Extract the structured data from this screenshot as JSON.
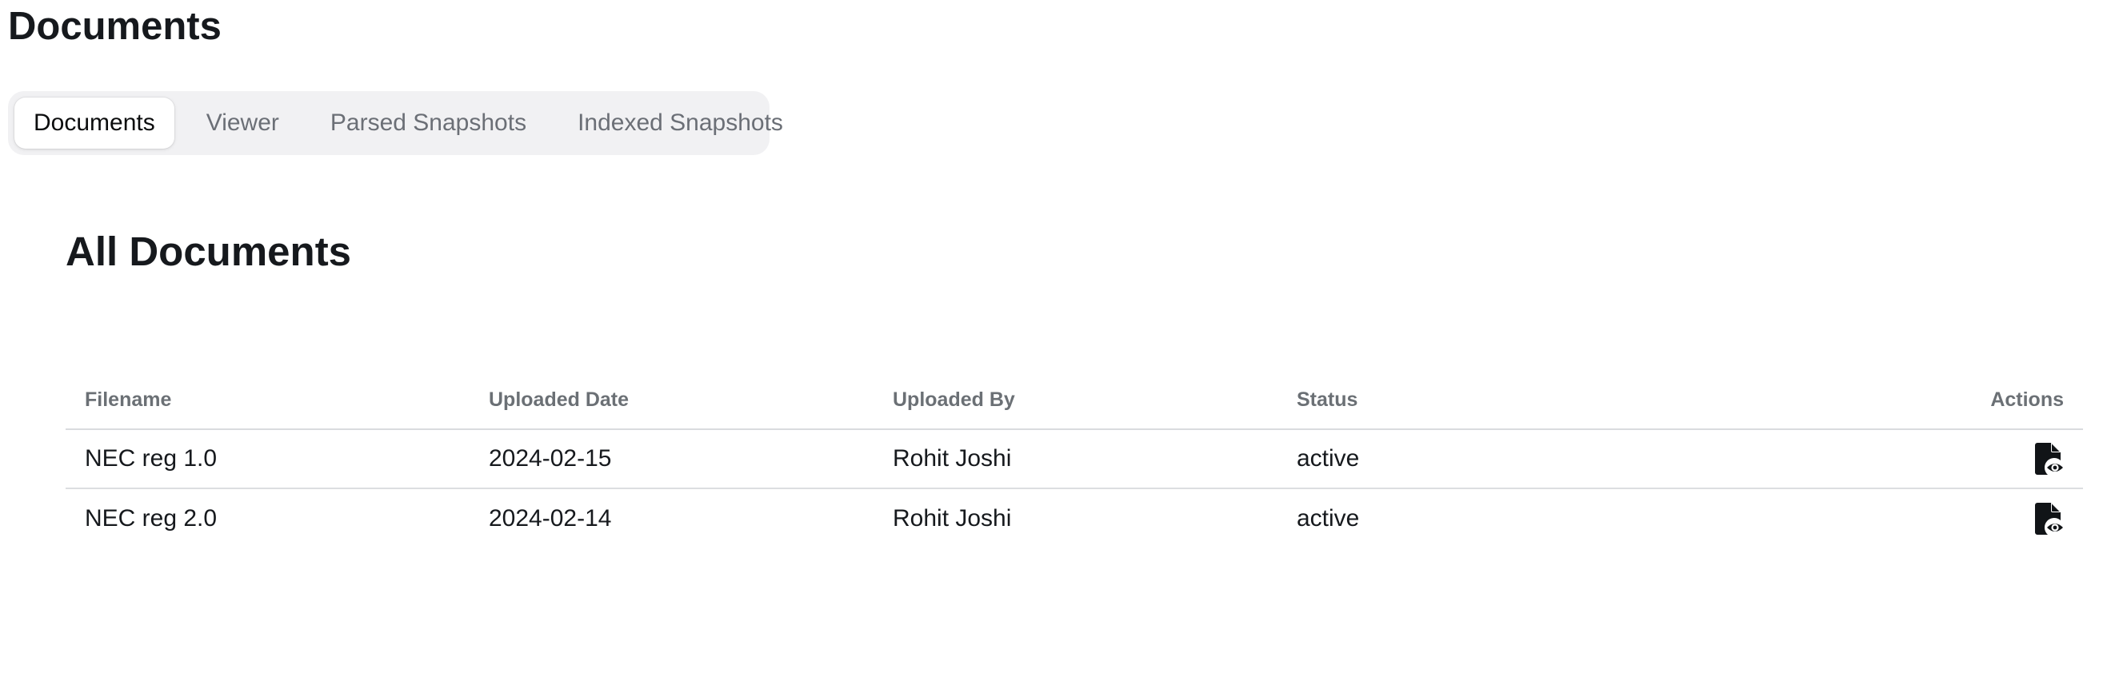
{
  "page": {
    "title": "Documents"
  },
  "tabs": [
    {
      "label": "Documents",
      "active": true
    },
    {
      "label": "Viewer",
      "active": false
    },
    {
      "label": "Parsed Snapshots",
      "active": false
    },
    {
      "label": "Indexed Snapshots",
      "active": false
    }
  ],
  "section": {
    "title": "All Documents"
  },
  "table": {
    "headers": {
      "filename": "Filename",
      "uploaded_date": "Uploaded Date",
      "uploaded_by": "Uploaded By",
      "status": "Status",
      "actions": "Actions"
    },
    "rows": [
      {
        "filename": "NEC reg 1.0",
        "uploaded_date": "2024-02-15",
        "uploaded_by": "Rohit Joshi",
        "status": "active",
        "action_icon": "file-view-icon"
      },
      {
        "filename": "NEC reg 2.0",
        "uploaded_date": "2024-02-14",
        "uploaded_by": "Rohit Joshi",
        "status": "active",
        "action_icon": "file-view-icon"
      }
    ]
  }
}
